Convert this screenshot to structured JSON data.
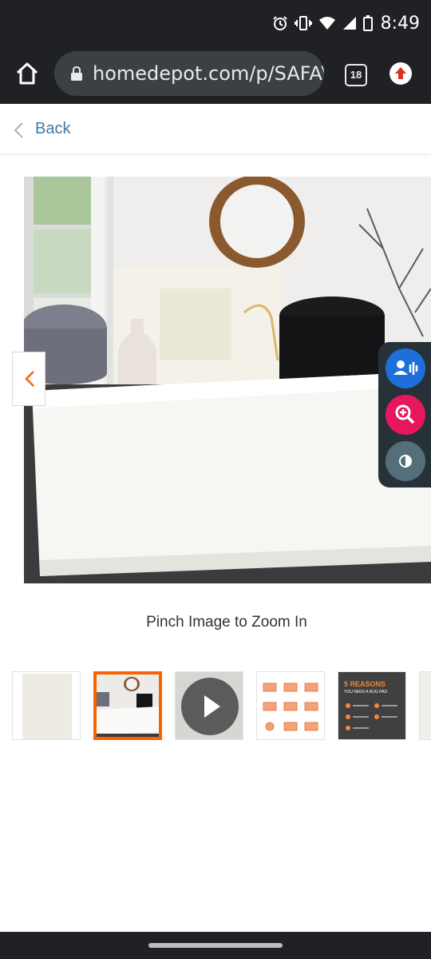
{
  "status_bar": {
    "time": "8:49",
    "icons": [
      "alarm-icon",
      "vibrate-icon",
      "wifi-icon",
      "signal-icon",
      "battery-icon"
    ]
  },
  "browser": {
    "url": "homedepot.com/p/SAFAVIEH",
    "tab_count": "18",
    "icons": [
      "home-icon",
      "lock-icon",
      "update-icon"
    ]
  },
  "page": {
    "back_label": "Back",
    "zoom_hint": "Pinch Image to Zoom In"
  },
  "thumbnails": [
    {
      "name": "thumbnail-rug-flat",
      "selected": false
    },
    {
      "name": "thumbnail-room-scene",
      "selected": true
    },
    {
      "name": "thumbnail-video",
      "selected": false
    },
    {
      "name": "thumbnail-size-guide",
      "selected": false
    },
    {
      "name": "thumbnail-rug-pad",
      "selected": false,
      "text": "5 REASONS",
      "subtext": "YOU NEED A RUG PAD"
    },
    {
      "name": "thumbnail-extra",
      "selected": false
    }
  ],
  "accessibility": {
    "buttons": [
      "voice-assist-icon",
      "zoom-in-icon",
      "contrast-icon"
    ]
  },
  "colors": {
    "brand_orange": "#f96302",
    "link_blue": "#3d7aa6",
    "chrome_dark": "#202124",
    "access_blue": "#1e6fd9",
    "access_pink": "#e8175d",
    "access_slate": "#546e7a"
  }
}
